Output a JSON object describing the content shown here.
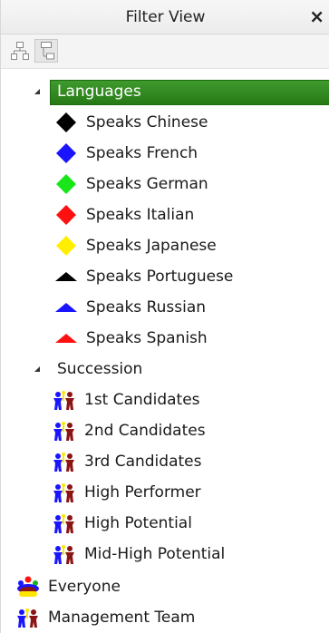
{
  "window": {
    "title": "Filter View",
    "close_label": "×"
  },
  "toolbar": {
    "buttons": [
      {
        "icon": "hierarchy-icon",
        "active": false
      },
      {
        "icon": "tree-list-icon",
        "active": true
      }
    ]
  },
  "tree": {
    "groups": [
      {
        "label": "Languages",
        "expanded": true,
        "selected": true,
        "items": [
          {
            "label": "Speaks Chinese",
            "icon": "diamond-icon",
            "color": "#000000"
          },
          {
            "label": "Speaks French",
            "icon": "diamond-icon",
            "color": "#1a14ff"
          },
          {
            "label": "Speaks German",
            "icon": "diamond-icon",
            "color": "#19e619"
          },
          {
            "label": "Speaks Italian",
            "icon": "diamond-icon",
            "color": "#ff1010"
          },
          {
            "label": "Speaks Japanese",
            "icon": "diamond-icon",
            "color": "#ffee00"
          },
          {
            "label": "Speaks Portuguese",
            "icon": "triangle-icon",
            "color": "#000000"
          },
          {
            "label": "Speaks Russian",
            "icon": "triangle-icon",
            "color": "#1a14ff"
          },
          {
            "label": "Speaks Spanish",
            "icon": "triangle-icon",
            "color": "#ff1010"
          }
        ]
      },
      {
        "label": "Succession",
        "expanded": true,
        "selected": false,
        "items": [
          {
            "label": "1st Candidates",
            "icon": "people-icon"
          },
          {
            "label": "2nd Candidates",
            "icon": "people-icon"
          },
          {
            "label": "3rd Candidates",
            "icon": "people-icon"
          },
          {
            "label": "High Performer",
            "icon": "people-icon"
          },
          {
            "label": "High Potential",
            "icon": "people-icon"
          },
          {
            "label": "Mid-High Potential",
            "icon": "people-icon"
          }
        ]
      }
    ],
    "root_items": [
      {
        "label": "Everyone",
        "icon": "group-icon"
      },
      {
        "label": "Management Team",
        "icon": "people-icon"
      }
    ]
  }
}
